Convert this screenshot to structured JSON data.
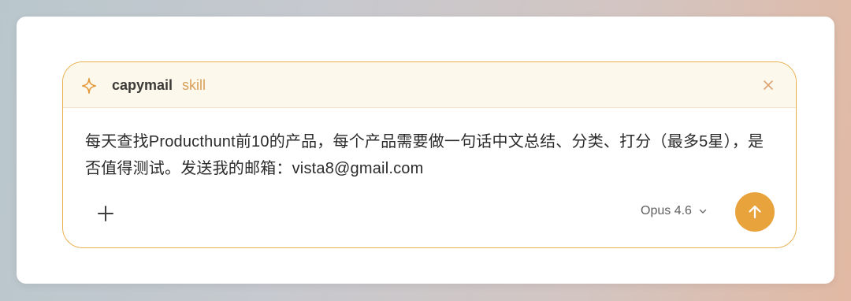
{
  "skill": {
    "name": "capymail",
    "tag": "skill",
    "icon": "sparkle-icon",
    "close_icon": "close-icon"
  },
  "prompt": {
    "text": "每天查找Producthunt前10的产品，每个产品需要做一句话中文总结、分类、打分（最多5星），是否值得测试。发送我的邮箱：vista8@gmail.com"
  },
  "toolbar": {
    "add_icon": "plus-icon",
    "model_label": "Opus 4.6",
    "model_chevron": "chevron-down-icon",
    "send_icon": "arrow-up-icon"
  },
  "colors": {
    "accent": "#e8a33c",
    "border": "#e8b04f",
    "header_bg": "#fdf8ec",
    "skill_tag": "#d9a05a"
  }
}
